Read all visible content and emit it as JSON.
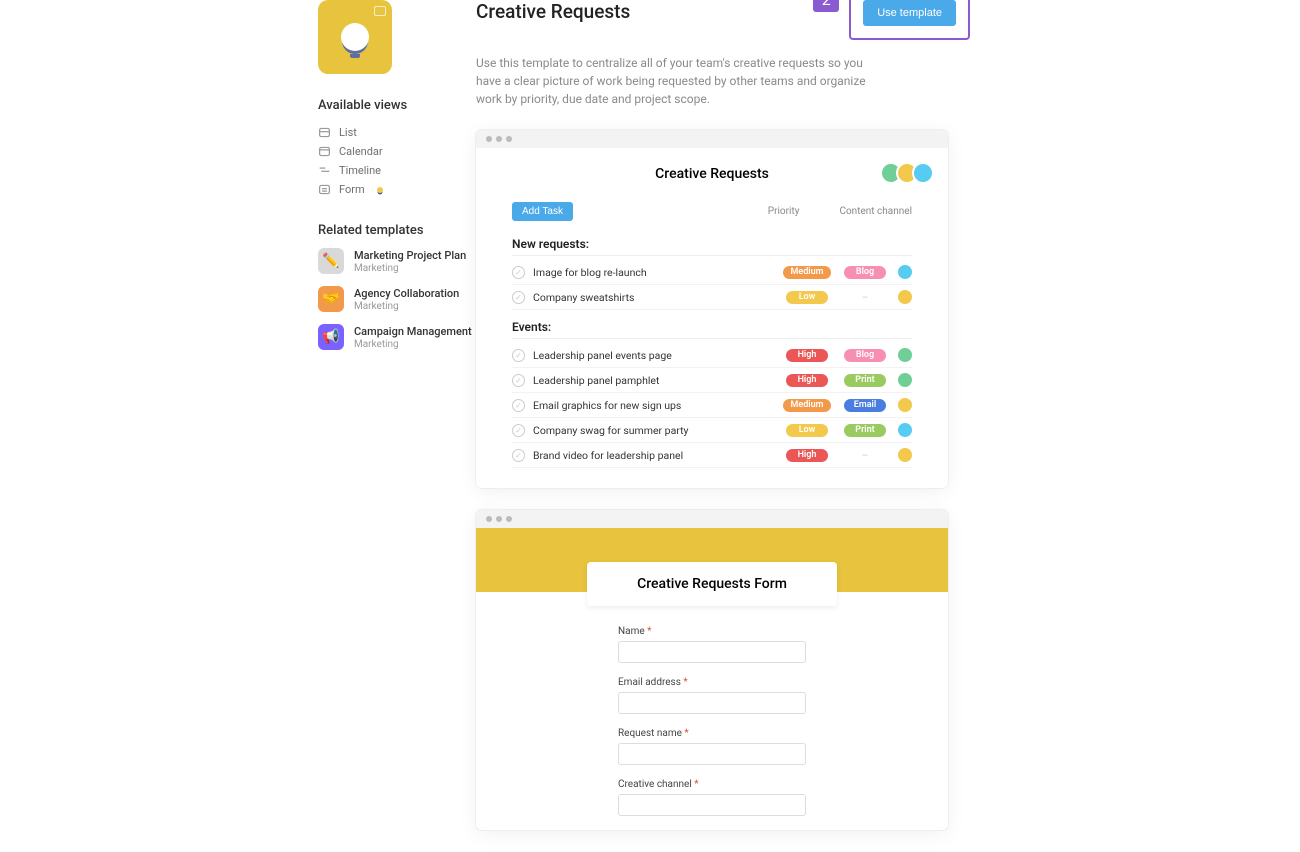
{
  "header": {
    "title": "Creative Requests",
    "description": "Use this template to centralize all of your team's creative requests so you have a clear picture of work being requested by other teams and organize work by priority, due date and project scope.",
    "step_number": "2",
    "use_button": "Use template"
  },
  "sidebar": {
    "views_heading": "Available views",
    "views": [
      "List",
      "Calendar",
      "Timeline",
      "Form"
    ],
    "related_heading": "Related templates",
    "related": [
      {
        "name": "Marketing Project Plan",
        "category": "Marketing",
        "icon_bg": "#d9d9d9",
        "emoji": "✏️"
      },
      {
        "name": "Agency Collaboration",
        "category": "Marketing",
        "icon_bg": "#f2994a",
        "emoji": "🤝"
      },
      {
        "name": "Campaign Management",
        "category": "Marketing",
        "icon_bg": "#7b61ff",
        "emoji": "📢"
      }
    ]
  },
  "preview1": {
    "title": "Creative Requests",
    "add_task": "Add Task",
    "col_priority": "Priority",
    "col_channel": "Content channel",
    "avatars": [
      "#6fcf97",
      "#f2c94c",
      "#56ccf2"
    ],
    "sections": [
      {
        "name": "New requests:",
        "tasks": [
          {
            "title": "Image for blog re-launch",
            "priority": {
              "label": "Medium",
              "color": "#f2994a"
            },
            "channel": {
              "label": "Blog",
              "color": "#f78fb3"
            },
            "avatar": "#56ccf2"
          },
          {
            "title": "Company sweatshirts",
            "priority": {
              "label": "Low",
              "color": "#f2c94c"
            },
            "channel": null,
            "avatar": "#f2c94c"
          }
        ]
      },
      {
        "name": "Events:",
        "tasks": [
          {
            "title": "Leadership panel events page",
            "priority": {
              "label": "High",
              "color": "#eb5757"
            },
            "channel": {
              "label": "Blog",
              "color": "#f78fb3"
            },
            "avatar": "#6fcf97"
          },
          {
            "title": "Leadership panel pamphlet",
            "priority": {
              "label": "High",
              "color": "#eb5757"
            },
            "channel": {
              "label": "Print",
              "color": "#9acb60"
            },
            "avatar": "#6fcf97"
          },
          {
            "title": "Email graphics for new sign ups",
            "priority": {
              "label": "Medium",
              "color": "#f2994a"
            },
            "channel": {
              "label": "Email",
              "color": "#4a7de0"
            },
            "avatar": "#f2c94c"
          },
          {
            "title": "Company swag for summer party",
            "priority": {
              "label": "Low",
              "color": "#f2c94c"
            },
            "channel": {
              "label": "Print",
              "color": "#9acb60"
            },
            "avatar": "#56ccf2"
          },
          {
            "title": "Brand video for leadership panel",
            "priority": {
              "label": "High",
              "color": "#eb5757"
            },
            "channel": null,
            "avatar": "#f2c94c"
          }
        ]
      }
    ]
  },
  "preview2": {
    "title": "Creative Requests Form",
    "fields": [
      {
        "label": "Name",
        "required": true
      },
      {
        "label": "Email address",
        "required": true
      },
      {
        "label": "Request name",
        "required": true
      },
      {
        "label": "Creative channel",
        "required": true
      }
    ]
  }
}
